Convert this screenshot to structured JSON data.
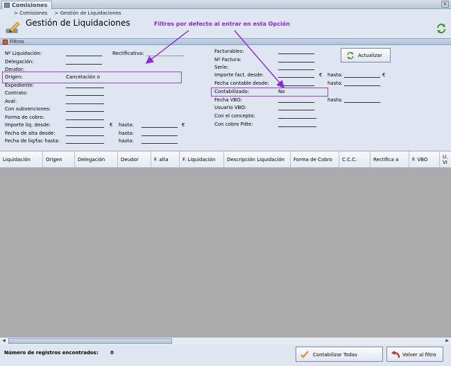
{
  "window": {
    "tab_label": "Comisiones"
  },
  "breadcrumbs": [
    "> Comisiones",
    "> Gestión de Liquidaciones"
  ],
  "page_title": "Gestión de Liquidaciones",
  "annotation": "Filtros por defecto al entrar en esta Opción",
  "filters_header": "Filtros",
  "filters": {
    "num_liquidacion": "Nº Liquidación:",
    "rectificativa": "Rectificativa:",
    "delegacion": "Delegación:",
    "deudor": "Deudor:",
    "origen": "Origen:",
    "origen_value": "Cancelación o",
    "expediente": "Expediente:",
    "contrato": "Contrato:",
    "aval": "Aval:",
    "con_subvenciones": "Con subvenciones:",
    "forma_cobro": "Forma de cobro:",
    "importe_liq_desde": "Importe liq. desde:",
    "fecha_alta_desde": "Fecha de alta desde:",
    "fecha_liq_hasta": "Fecha de liq/fac hasta:",
    "hasta": "hasta:",
    "euro": "€",
    "facturables": "Facturables:",
    "num_factura": "Nº Factura:",
    "serie": "Serie:",
    "importe_fact_desde": "Importe fact. desde:",
    "fecha_contable_desde": "Fecha contable desde:",
    "contabilizado": "Contabilizado:",
    "contabilizado_value": "No",
    "fecha_vbo": "Fecha VBO:",
    "usuario_vbo": "Usuario VBO:",
    "con_el_concepto": "Con el concepto:",
    "con_cobro_pdte": "Con cobro Pdte:"
  },
  "actualizar_label": "Actualizar",
  "columns": [
    {
      "label": "Liquidación"
    },
    {
      "label": "Origen"
    },
    {
      "label": "Delegación"
    },
    {
      "label": "Deudor"
    },
    {
      "label": "F. alta"
    },
    {
      "label": "F. Liquidación"
    },
    {
      "label": "Descripción Liquidación"
    },
    {
      "label": "Forma de Cobro"
    },
    {
      "label": "C.C.C."
    },
    {
      "label": "Rectifica a"
    },
    {
      "label": "F. VBO"
    },
    {
      "label": "U. VI"
    }
  ],
  "footer": {
    "num_registros_label": "Número de registros encontrados:",
    "num_registros_value": "0",
    "contabilizar_label": "Contabilizar Todas",
    "volver_label": "Volver al filtro"
  },
  "colors": {
    "annotation": "#8b26e6",
    "grid_body": "#ababab",
    "panel_bg": "#dde6f1"
  },
  "icons": [
    "pencil-icon",
    "refresh-icon",
    "close-icon",
    "checkmark-icon",
    "back-arrow-icon"
  ]
}
